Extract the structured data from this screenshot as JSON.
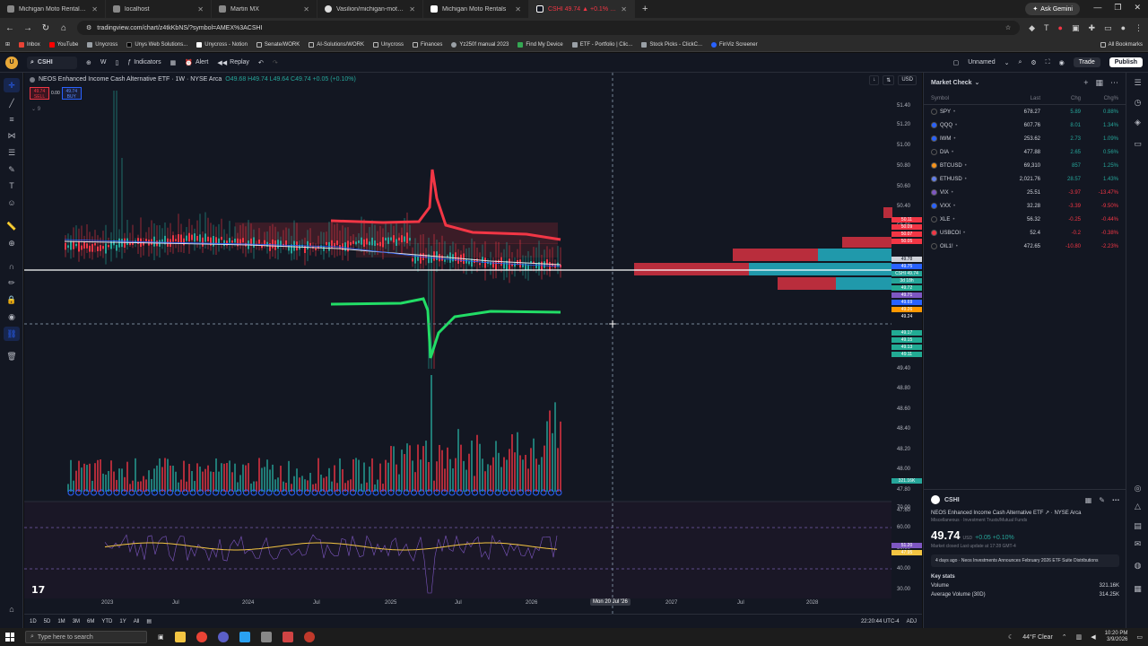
{
  "browser": {
    "tabs": [
      {
        "title": "Michigan Moto Rentals Website",
        "active": false
      },
      {
        "title": "localhost",
        "active": false
      },
      {
        "title": "Martin MX",
        "active": false
      },
      {
        "title": "Vasilion/michigan-moto-rentals",
        "active": false
      },
      {
        "title": "Michigan Moto Rentals",
        "active": false
      },
      {
        "title": "CSHI 49.74 ▲ +0.1% Unnamed",
        "active": true
      }
    ],
    "gemini_label": "Ask Gemini",
    "url": "tradingview.com/chart/z4tkKbNS/?symbol=AMEX%3ACSHI",
    "bookmarks": [
      "Inbox",
      "YouTube",
      "Unycross",
      "Unys Web Solutions...",
      "Unycross - Notion",
      "Senate/WORK",
      "AI-Solutions/WORK",
      "Unycross",
      "Finances",
      "Yz250f manual 2023",
      "Find My Device",
      "ETF - Portfolio | Clic...",
      "Stock Picks - ClickC...",
      "FinViz Screener"
    ],
    "all_bookmarks": "All Bookmarks"
  },
  "toolbar": {
    "avatar": "U",
    "symbol": "CSHI",
    "interval": "W",
    "indicators": "Indicators",
    "alert": "Alert",
    "replay": "Replay",
    "layout_name": "Unnamed",
    "trade": "Trade",
    "publish": "Publish"
  },
  "chart": {
    "legend_title": "NEOS Enhanced Income Cash Alternative ETF · 1W · NYSE Arca",
    "ohlc": "O49.68 H49.74 L49.64 C49.74 +0.05 (+0.10%)",
    "sell_price": "49.74",
    "sell_label": "SELL",
    "spread": "0.00",
    "buy_price": "49.74",
    "buy_label": "BUY",
    "indicator_badge": "9",
    "currency": "USD",
    "price_ticks": [
      "51.40",
      "51.20",
      "51.00",
      "50.80",
      "50.60",
      "50.40",
      "50.20",
      "49.40",
      "48.80",
      "48.60",
      "48.40",
      "48.20",
      "48.00",
      "47.80",
      "47.60"
    ],
    "osc_ticks": [
      "70.00",
      "60.00",
      "50.00",
      "40.00",
      "30.00"
    ],
    "price_labels_red": [
      "50.11",
      "50.09",
      "50.07",
      "50.05"
    ],
    "price_labels_misc": [
      {
        "text": "49.78",
        "color": "#cfd2da"
      },
      {
        "text": "49.75",
        "color": "#2962ff"
      },
      {
        "text": "CSHI 49.74",
        "color": "#26a69a"
      },
      {
        "text": "3d 18h",
        "color": "#26a69a"
      },
      {
        "text": "49.72",
        "color": "#22ab94"
      },
      {
        "text": "49.71",
        "color": "#7e57c2"
      },
      {
        "text": "49.69",
        "color": "#2962ff"
      },
      {
        "text": "49.26",
        "color": "#ff9800"
      },
      {
        "text": "49.24",
        "color": "#131722"
      }
    ],
    "price_labels_green": [
      "49.17",
      "49.15",
      "49.13",
      "49.11"
    ],
    "volume_label": "321.16K",
    "rsi_labels": [
      "51.20",
      "47.95"
    ],
    "time_labels": [
      "2023",
      "Jul",
      "2024",
      "Jul",
      "2025",
      "Jul",
      "2026",
      "2027",
      "Jul",
      "2028",
      "Jul"
    ],
    "crosshair_time": "Mon 20 Jul '26",
    "chart_data": {
      "type": "candlestick",
      "title": "NEOS Enhanced Income Cash Alternative ETF · 1W · NYSE Arca",
      "symbol": "CSHI",
      "interval": "1W",
      "ylim": [
        47.6,
        51.4
      ],
      "last": 49.74,
      "volume_last": "321.16K",
      "rsi_ylim": [
        30,
        70
      ]
    }
  },
  "ranges": [
    "1D",
    "5D",
    "1M",
    "3M",
    "6M",
    "YTD",
    "1Y",
    "All"
  ],
  "bottom_time": "22:20:44 UTC-4",
  "bottom_adj": "ADJ",
  "watchlist": {
    "title": "Market Check",
    "cols": [
      "Symbol",
      "Last",
      "Chg",
      "Chg%"
    ],
    "rows": [
      {
        "sym": "SPY",
        "last": "678.27",
        "chg": "5.89",
        "chgp": "0.88%",
        "dir": "pos",
        "color": "#131722"
      },
      {
        "sym": "QQQ",
        "last": "607.76",
        "chg": "8.01",
        "chgp": "1.34%",
        "dir": "pos",
        "color": "#2962ff"
      },
      {
        "sym": "IWM",
        "last": "253.62",
        "chg": "2.73",
        "chgp": "1.09%",
        "dir": "pos",
        "color": "#2962ff"
      },
      {
        "sym": "DIA",
        "last": "477.88",
        "chg": "2.65",
        "chgp": "0.56%",
        "dir": "pos",
        "color": "#131722"
      },
      {
        "sym": "BTCUSD",
        "last": "69,310",
        "chg": "857",
        "chgp": "1.25%",
        "dir": "pos",
        "color": "#f7931a"
      },
      {
        "sym": "ETHUSD",
        "last": "2,021.76",
        "chg": "28.57",
        "chgp": "1.43%",
        "dir": "pos",
        "color": "#627eea"
      },
      {
        "sym": "VIX",
        "last": "25.51",
        "chg": "-3.97",
        "chgp": "-13.47%",
        "dir": "neg",
        "color": "#7e57c2"
      },
      {
        "sym": "VXX",
        "last": "32.28",
        "chg": "-3.39",
        "chgp": "-9.50%",
        "dir": "neg",
        "color": "#2962ff"
      },
      {
        "sym": "XLE",
        "last": "56.32",
        "chg": "-0.25",
        "chgp": "-0.44%",
        "dir": "neg",
        "color": "#131722"
      },
      {
        "sym": "USBCOI",
        "last": "52.4",
        "chg": "-0.2",
        "chgp": "-0.38%",
        "dir": "neg",
        "color": "#f23645"
      },
      {
        "sym": "OIL1!",
        "last": "472.65",
        "chg": "-10.80",
        "chgp": "-2.23%",
        "dir": "neg",
        "color": "#131722"
      }
    ]
  },
  "details": {
    "symbol": "CSHI",
    "name": "NEOS Enhanced Income Cash Alternative ETF",
    "exchange": "NYSE Arca",
    "category": "Miscellaneous · Investment Trusts/Mutual Funds",
    "price": "49.74",
    "currency": "USD",
    "change": "+0.05 +0.10%",
    "status": "Market closed",
    "last_update": "Last update at 17:28 GMT-4",
    "news": "4 days ago · Neos Investments Announces February 2026 ETF Suite Distributions",
    "key_stats": "Key stats",
    "volume_label": "Volume",
    "volume": "321.16K",
    "avg_volume_label": "Average Volume (30D)",
    "avg_volume": "314.25K"
  },
  "taskbar": {
    "search_placeholder": "Type here to search",
    "weather": "44°F Clear",
    "time": "10:20 PM",
    "date": "3/9/2026"
  }
}
